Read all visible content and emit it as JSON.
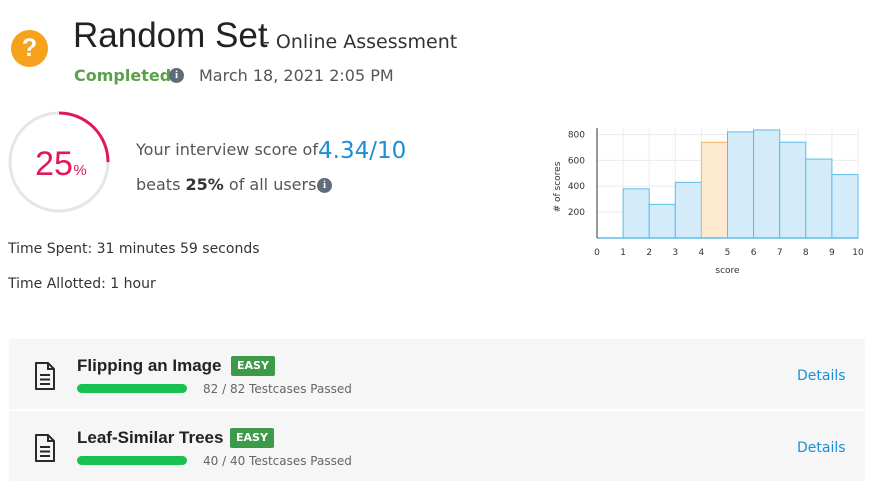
{
  "header": {
    "icon": "question-icon",
    "accent": "#f7a21c",
    "title": "Random Set",
    "subtitle": "- Online Assessment",
    "status": "Completed",
    "status_color": "#5aa14a",
    "date": "March 18, 2021 2:05 PM"
  },
  "score": {
    "percent_value": 25,
    "percent_number": "25",
    "percent_sign": "%",
    "ring_color": "#e0195c",
    "line1": "Your interview score of",
    "value": "4.34/10",
    "beats_prefix": "beats",
    "beats_value": "25%",
    "beats_suffix": "of all users."
  },
  "times": {
    "spent": "Time Spent: 31 minutes 59 seconds",
    "allotted": "Time Allotted: 1 hour"
  },
  "chart_data": {
    "type": "bar",
    "xlabel": "score",
    "ylabel": "# of scores",
    "x_ticks": [
      "0",
      "1",
      "2",
      "3",
      "4",
      "5",
      "6",
      "7",
      "8",
      "9",
      "10"
    ],
    "y_ticks": [
      "200",
      "400",
      "600",
      "800"
    ],
    "xlim": [
      0,
      10
    ],
    "ylim": [
      0,
      850
    ],
    "bins": [
      {
        "start": 1,
        "end": 2,
        "value": 380
      },
      {
        "start": 2,
        "end": 3,
        "value": 260
      },
      {
        "start": 3,
        "end": 4,
        "value": 430
      },
      {
        "start": 4,
        "end": 5,
        "value": 740,
        "highlighted": true
      },
      {
        "start": 5,
        "end": 6,
        "value": 820
      },
      {
        "start": 6,
        "end": 7,
        "value": 835
      },
      {
        "start": 7,
        "end": 8,
        "value": 740
      },
      {
        "start": 8,
        "end": 9,
        "value": 610
      },
      {
        "start": 9,
        "end": 10,
        "value": 490
      }
    ],
    "colors": {
      "bar": "#d4ecfa",
      "bar_stroke": "#5bbde8",
      "highlight": "#fde9cf",
      "highlight_stroke": "#f5b25d"
    },
    "grid": true
  },
  "problems": [
    {
      "icon": "document-icon",
      "title": "Flipping an Image",
      "difficulty": "EASY",
      "progress": 1.0,
      "passed": "82 / 82 Testcases Passed",
      "link": "Details"
    },
    {
      "icon": "document-icon",
      "title": "Leaf-Similar Trees",
      "difficulty": "EASY",
      "progress": 1.0,
      "passed": "40 / 40 Testcases Passed",
      "link": "Details"
    }
  ]
}
